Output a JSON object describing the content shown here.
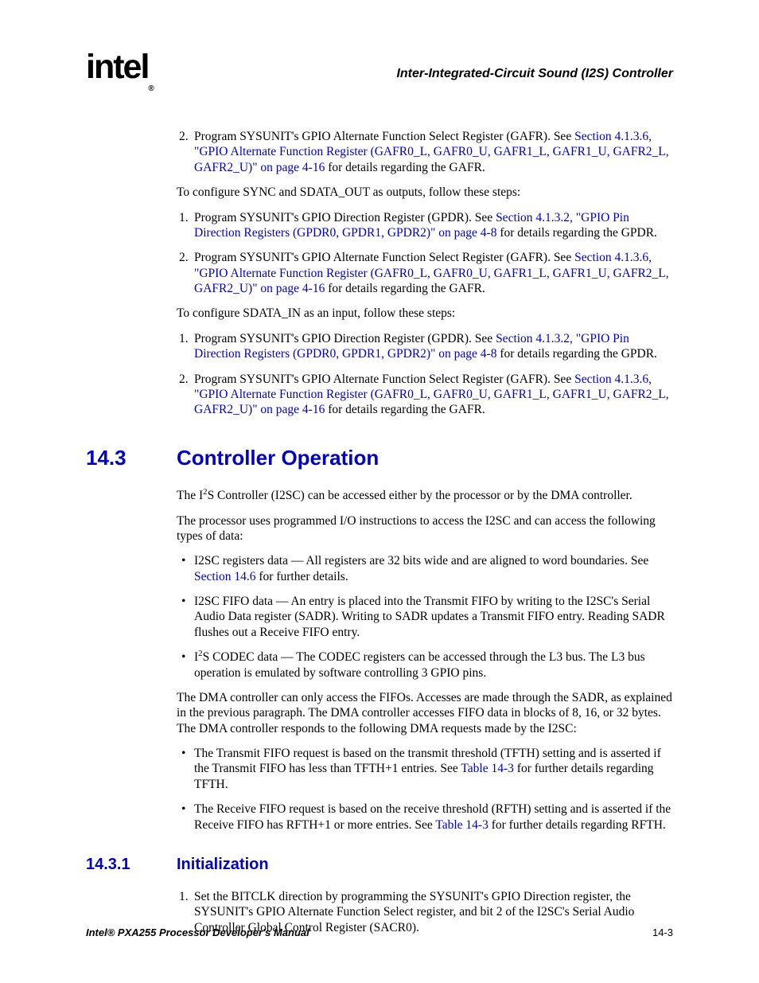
{
  "logo": {
    "text": "intel",
    "reg": "®"
  },
  "header": {
    "title": "Inter-Integrated-Circuit Sound (I2S) Controller"
  },
  "top_list": {
    "item2": {
      "prefix": "Program SYSUNIT's GPIO Alternate Function Select Register (GAFR). See ",
      "link": "Section 4.1.3.6, \"GPIO Alternate Function Register (GAFR0_L, GAFR0_U, GAFR1_L, GAFR1_U, GAFR2_L, GAFR2_U)\" on page 4-16",
      "suffix": " for details regarding the GAFR."
    }
  },
  "p_sync": "To configure SYNC and SDATA_OUT as outputs, follow these steps:",
  "sync_list": {
    "i1": {
      "prefix": "Program SYSUNIT's GPIO Direction Register (GPDR). See ",
      "link": "Section 4.1.3.2, \"GPIO Pin Direction Registers (GPDR0, GPDR1, GPDR2)\" on page 4-8",
      "suffix": " for details regarding the GPDR."
    },
    "i2": {
      "prefix": "Program SYSUNIT's GPIO Alternate Function Select Register (GAFR). See ",
      "link": "Section 4.1.3.6, \"GPIO Alternate Function Register (GAFR0_L, GAFR0_U, GAFR1_L, GAFR1_U, GAFR2_L, GAFR2_U)\" on page 4-16",
      "suffix": " for details regarding the GAFR."
    }
  },
  "p_sdata": "To configure SDATA_IN as an input, follow these steps:",
  "sdata_list": {
    "i1": {
      "prefix": "Program SYSUNIT's GPIO Direction Register (GPDR). See ",
      "link": "Section 4.1.3.2, \"GPIO Pin Direction Registers (GPDR0, GPDR1, GPDR2)\" on page 4-8",
      "suffix": " for details regarding the GPDR."
    },
    "i2": {
      "prefix": "Program SYSUNIT's GPIO Alternate Function Select Register (GAFR). See ",
      "link": "Section 4.1.3.6, \"GPIO Alternate Function Register (GAFR0_L, GAFR0_U, GAFR1_L, GAFR1_U, GAFR2_L, GAFR2_U)\" on page 4-16",
      "suffix": " for details regarding the GAFR."
    }
  },
  "sec_14_3": {
    "num": "14.3",
    "title": "Controller Operation"
  },
  "p_ctrl_1a": "The I",
  "p_ctrl_1b": "S Controller (I2SC) can be accessed either by the processor or by the DMA controller.",
  "p_ctrl_2": "The processor uses programmed I/O instructions to access the I2SC and can access the following types of data:",
  "bul1": {
    "i1": {
      "prefix": "I2SC registers data — All registers are 32 bits wide and are aligned to word boundaries. See ",
      "link": "Section 14.6",
      "suffix": " for further details."
    },
    "i2": "I2SC FIFO data — An entry is placed into the Transmit FIFO by writing to the I2SC's Serial Audio Data register (SADR). Writing to SADR updates a Transmit FIFO entry. Reading SADR flushes out a Receive FIFO entry.",
    "i3a": "I",
    "i3b": "S CODEC data — The CODEC registers can be accessed through the L3 bus. The L3 bus operation is emulated by software controlling 3 GPIO pins."
  },
  "p_dma": "The DMA controller can only access the FIFOs. Accesses are made through the SADR, as explained in the previous paragraph. The DMA controller accesses FIFO data in blocks of 8, 16, or 32 bytes. The DMA controller responds to the following DMA requests made by the I2SC:",
  "bul2": {
    "i1": {
      "prefix": "The Transmit FIFO request is based on the transmit threshold (TFTH) setting and is asserted if the Transmit FIFO has less than TFTH+1 entries. See ",
      "link": "Table 14-3",
      "suffix": " for further details regarding TFTH."
    },
    "i2": {
      "prefix": "The Receive FIFO request is based on the receive threshold (RFTH) setting and is asserted if the Receive FIFO has RFTH+1 or more entries. See ",
      "link": "Table 14-3",
      "suffix": " for further details regarding RFTH."
    }
  },
  "sec_14_3_1": {
    "num": "14.3.1",
    "title": "Initialization"
  },
  "init_list": {
    "i1": "Set the BITCLK direction by programming the SYSUNIT's GPIO Direction register, the SYSUNIT's GPIO Alternate Function Select register, and bit 2 of the I2SC's Serial Audio Controller Global Control Register (SACR0)."
  },
  "footer": {
    "left": "Intel® PXA255 Processor Developer's Manual",
    "right": "14-3"
  }
}
